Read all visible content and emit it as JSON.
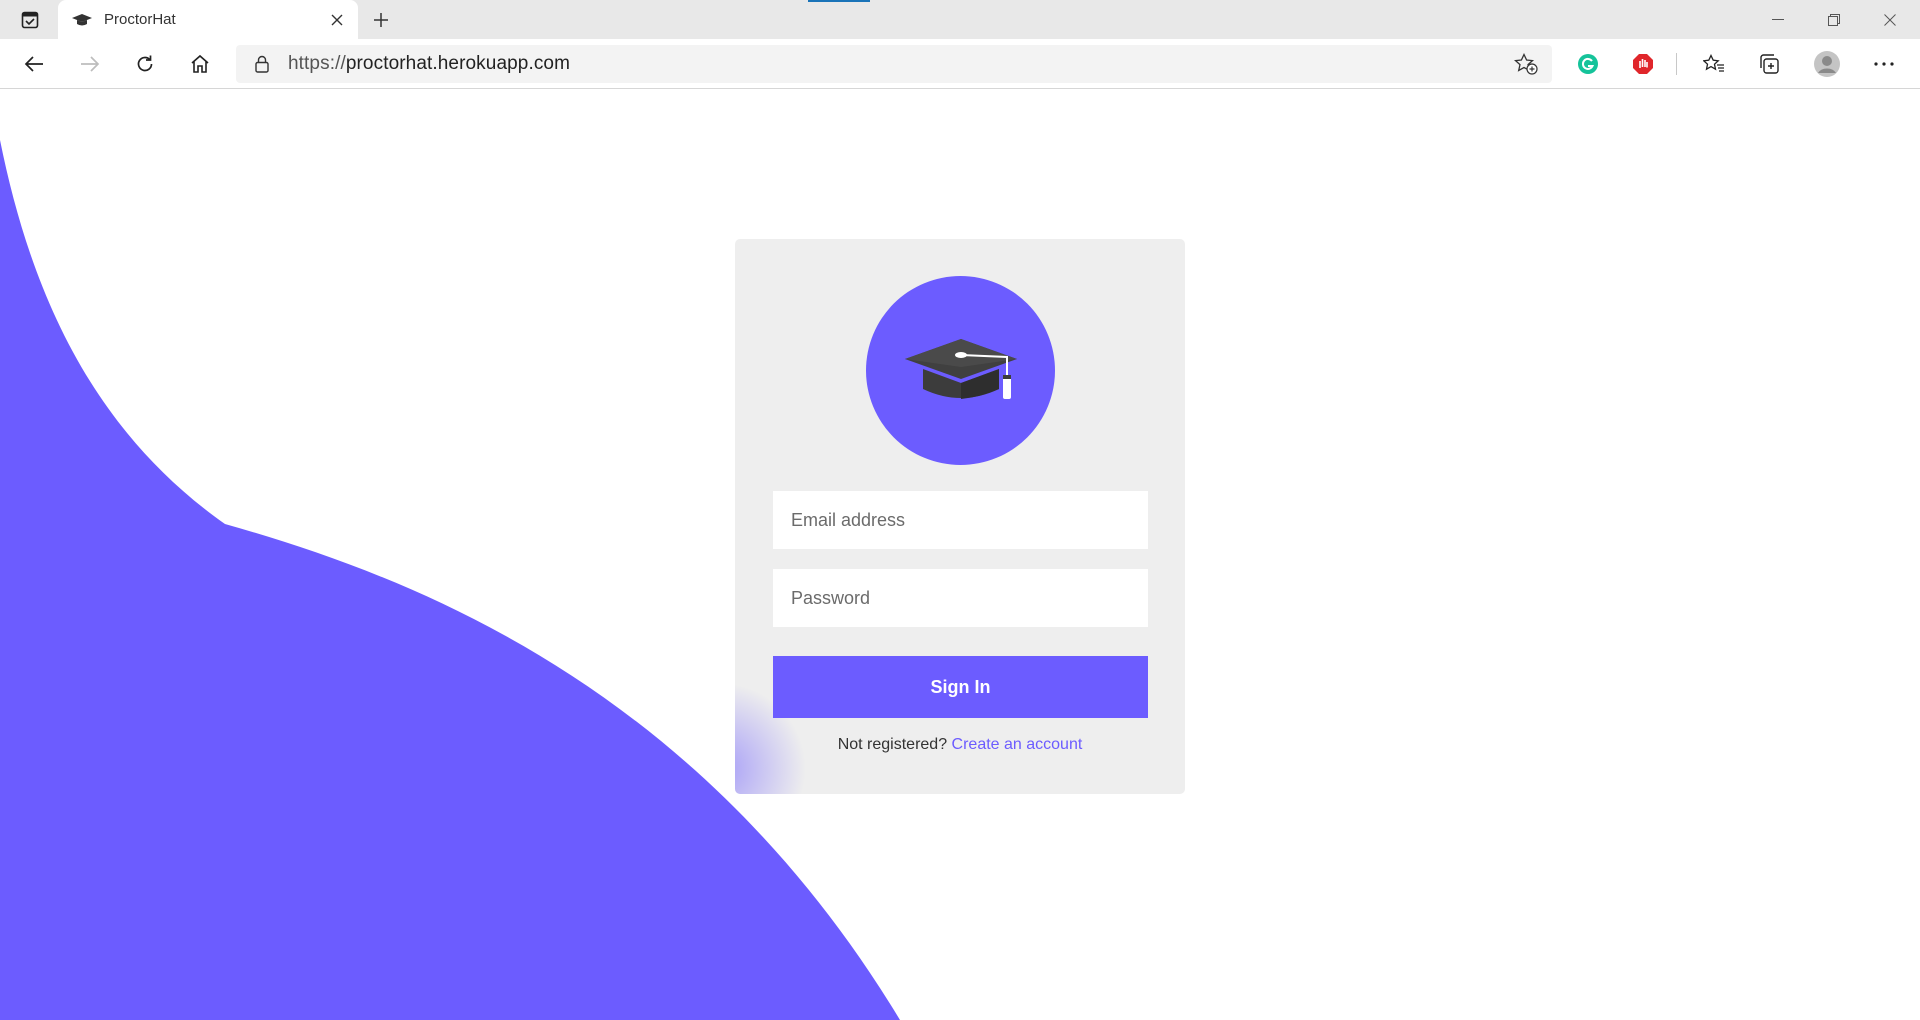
{
  "browser": {
    "tab_title": "ProctorHat",
    "url_protocol": "https://",
    "url_host": "proctorhat.herokuapp.com",
    "accent_color": "#1a73b8",
    "icons": [
      "tab-actions-icon",
      "graduation-cap-icon",
      "close-icon",
      "plus-icon",
      "minimize-icon",
      "restore-icon",
      "close-window-icon",
      "back-icon",
      "forward-icon",
      "refresh-icon",
      "home-icon",
      "lock-icon",
      "add-favorite-icon",
      "grammarly-icon",
      "adblock-icon",
      "favorites-icon",
      "collections-icon",
      "profile-icon",
      "more-icon"
    ]
  },
  "login": {
    "email_placeholder": "Email address",
    "password_placeholder": "Password",
    "signin_label": "Sign In",
    "not_registered": "Not registered?",
    "create_account": "Create an account",
    "brand_color": "#6c5cff"
  }
}
